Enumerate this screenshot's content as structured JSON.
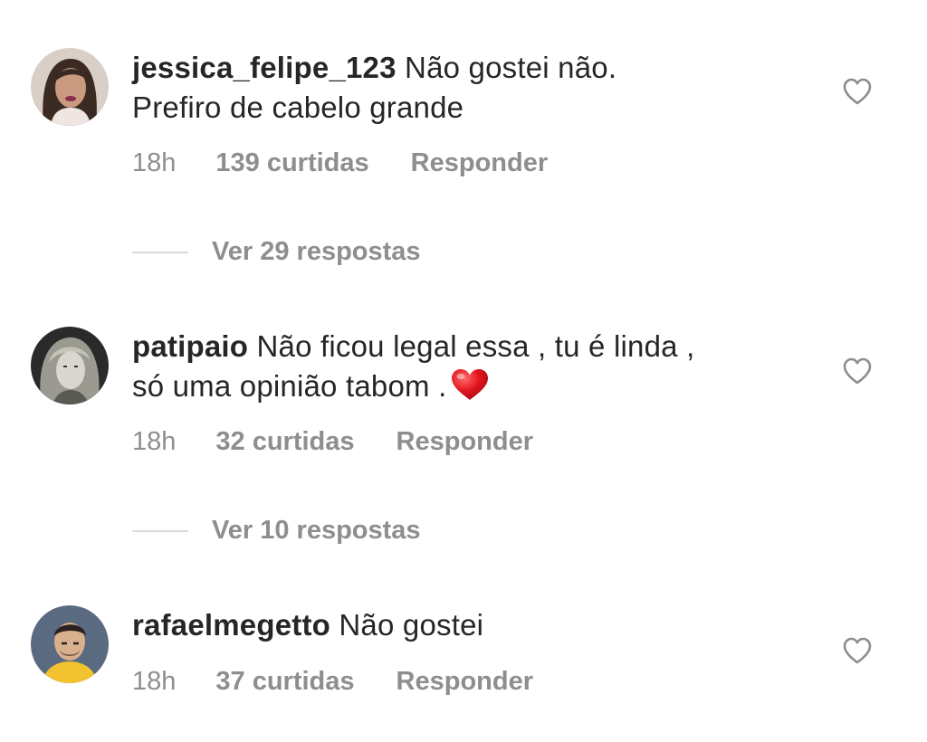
{
  "comments": [
    {
      "username": "jessica_felipe_123",
      "text_line1": "Não gostei não.",
      "text_line2": "Prefiro de cabelo grande",
      "time": "18h",
      "likes": "139 curtidas",
      "reply": "Responder",
      "view_replies": "Ver 29 respostas",
      "avatar_icon": "avatar-woman-dark-hair",
      "like_icon": "heart-outline-icon"
    },
    {
      "username": "patipaio",
      "text_line1": "Não ficou legal essa , tu é linda ,",
      "text_line2": "só uma opinião tabom .",
      "emoji": "red-heart-emoji",
      "time": "18h",
      "likes": "32 curtidas",
      "reply": "Responder",
      "view_replies": "Ver 10 respostas",
      "avatar_icon": "avatar-woman-blonde-bw",
      "like_icon": "heart-outline-icon"
    },
    {
      "username": "rafaelmegetto",
      "text_line1": "Não gostei",
      "time": "18h",
      "likes": "37 curtidas",
      "reply": "Responder",
      "avatar_icon": "avatar-man-yellow-shirt",
      "like_icon": "heart-outline-icon"
    }
  ],
  "colors": {
    "text": "#262626",
    "secondary": "#8e8e8e",
    "divider": "#dbdbdb",
    "heart_emoji": "#e0141e"
  }
}
